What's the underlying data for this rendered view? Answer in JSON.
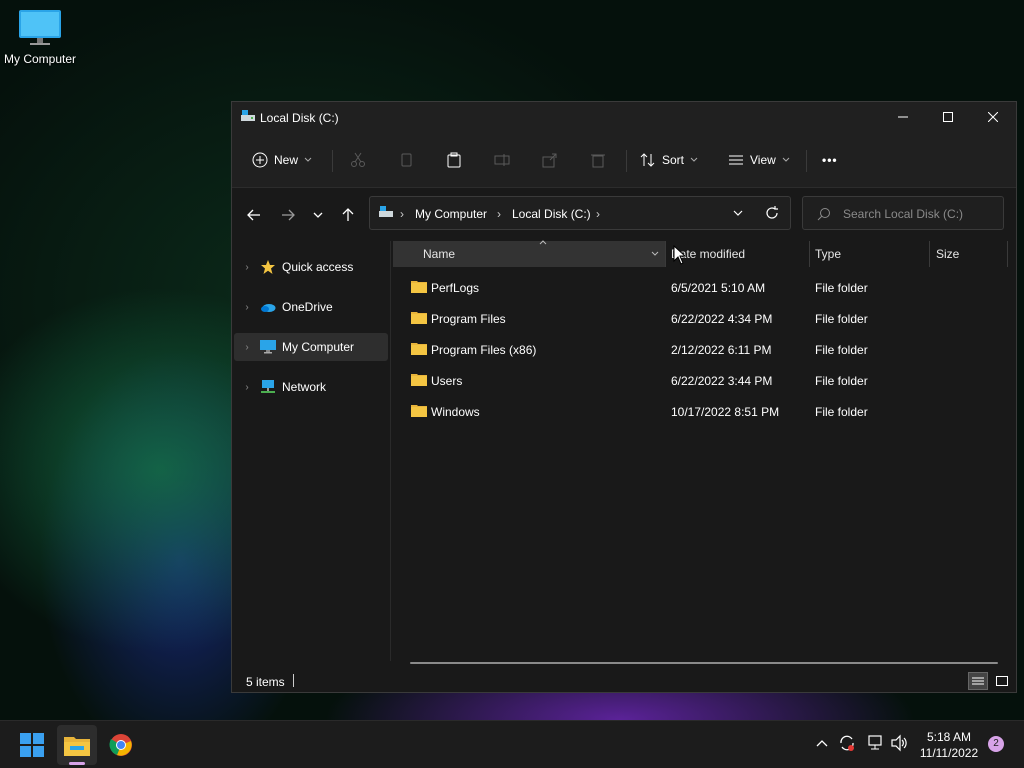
{
  "desktop": {
    "icon_label": "My Computer"
  },
  "window": {
    "title": "Local Disk (C:)",
    "controls": {
      "minimize": "–",
      "maximize": "□",
      "close": "✕"
    }
  },
  "toolbar": {
    "new_label": "New",
    "sort_label": "Sort",
    "view_label": "View",
    "more_label": "•••"
  },
  "address": {
    "segments": [
      "My Computer",
      "Local Disk (C:)"
    ],
    "separator": "›"
  },
  "search": {
    "placeholder": "Search Local Disk (C:)"
  },
  "navigation": {
    "items": [
      {
        "label": "Quick access",
        "icon": "star-icon"
      },
      {
        "label": "OneDrive",
        "icon": "cloud-icon"
      },
      {
        "label": "My Computer",
        "icon": "computer-icon",
        "selected": true
      },
      {
        "label": "Network",
        "icon": "network-icon"
      }
    ]
  },
  "columns": {
    "name": "Name",
    "date": "Date modified",
    "type": "Type",
    "size": "Size"
  },
  "files": [
    {
      "name": "PerfLogs",
      "date": "6/5/2021 5:10 AM",
      "type": "File folder",
      "size": ""
    },
    {
      "name": "Program Files",
      "date": "6/22/2022 4:34 PM",
      "type": "File folder",
      "size": ""
    },
    {
      "name": "Program Files (x86)",
      "date": "2/12/2022 6:11 PM",
      "type": "File folder",
      "size": ""
    },
    {
      "name": "Users",
      "date": "6/22/2022 3:44 PM",
      "type": "File folder",
      "size": ""
    },
    {
      "name": "Windows",
      "date": "10/17/2022 8:51 PM",
      "type": "File folder",
      "size": ""
    }
  ],
  "status": {
    "count": "5 items"
  },
  "taskbar": {
    "time": "5:18 AM",
    "date": "11/11/2022",
    "notification_count": "2"
  },
  "colors": {
    "accent": "#0078d4",
    "folder": "#f4c542",
    "background": "#191919"
  }
}
